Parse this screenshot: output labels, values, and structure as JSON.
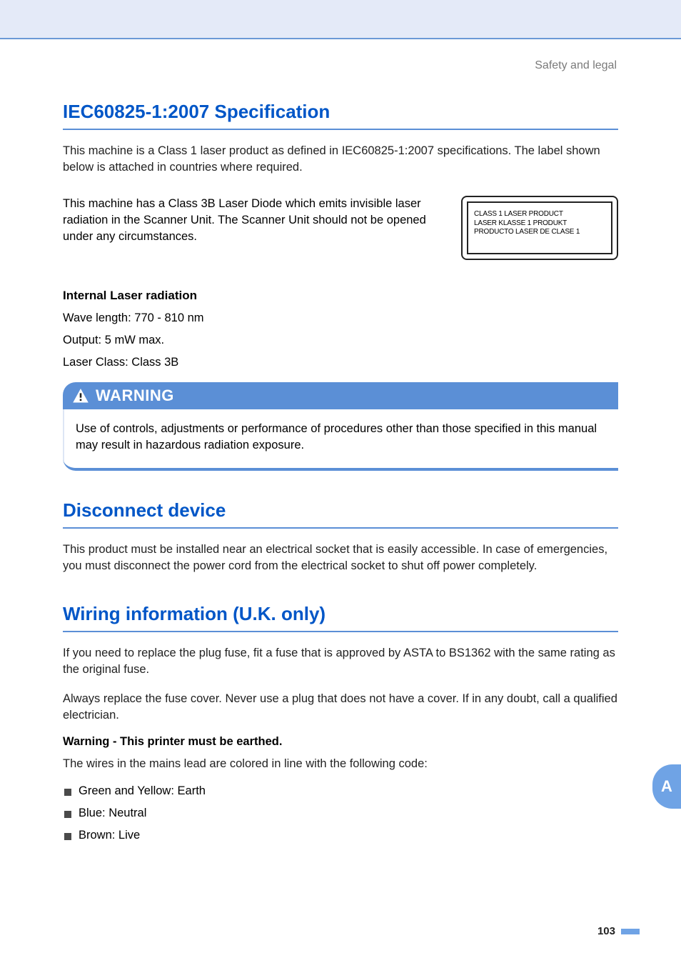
{
  "header": {
    "breadcrumb": "Safety and legal"
  },
  "sections": {
    "iec": {
      "heading": "IEC60825-1:2007 Specification",
      "intro": "This machine is a Class 1 laser product as defined in IEC60825-1:2007 specifications. The label shown below is attached in countries where required.",
      "diode_text": "This machine has a Class 3B Laser Diode which emits invisible laser radiation in the Scanner Unit. The Scanner Unit should not be opened under any circumstances.",
      "label": {
        "line1": "CLASS 1 LASER PRODUCT",
        "line2": "LASER KLASSE 1 PRODUKT",
        "line3": "PRODUCTO LASER DE CLASE 1"
      },
      "internal": {
        "heading": "Internal Laser radiation",
        "wave": "Wave length: 770 - 810 nm",
        "output": "Output: 5 mW max.",
        "class": "Laser Class: Class 3B"
      },
      "warning": {
        "title": "WARNING",
        "body": "Use of controls, adjustments or performance of procedures other than those specified in this manual may result in hazardous radiation exposure."
      }
    },
    "disconnect": {
      "heading": "Disconnect device",
      "body": "This product must be installed near an electrical socket that is easily accessible. In case of emergencies, you must disconnect the power cord from the electrical socket to shut off power completely."
    },
    "wiring": {
      "heading": "Wiring information (U.K. only)",
      "p1": "If you need to replace the plug fuse, fit a fuse that is approved by ASTA to BS1362 with the same rating as the original fuse.",
      "p2": "Always replace the fuse cover. Never use a plug that does not have a cover. If in any doubt, call a qualified electrician.",
      "warn": "Warning - This printer must be earthed.",
      "lead": "The wires in the mains lead are colored in line with the following code:",
      "items": {
        "earth": "Green and Yellow: Earth",
        "neutral": "Blue: Neutral",
        "live": "Brown: Live"
      }
    }
  },
  "sidebar": {
    "tab": "A"
  },
  "footer": {
    "page": "103"
  }
}
